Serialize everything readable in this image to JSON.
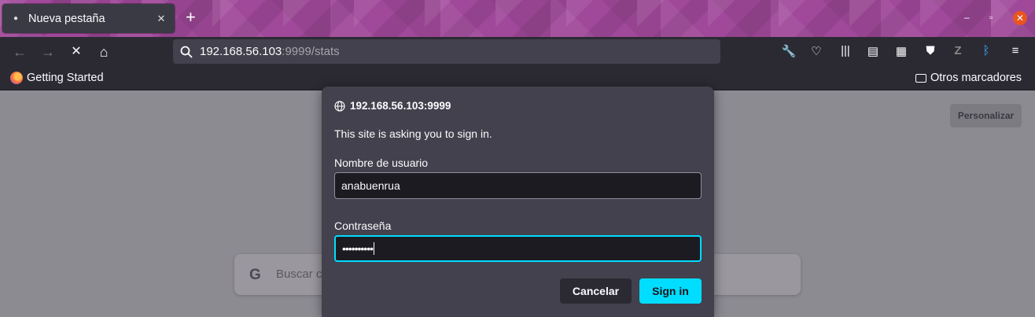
{
  "tab": {
    "title": "Nueva pestaña",
    "close_glyph": "✕",
    "new_tab_glyph": "+",
    "icon": "firefox-mask-icon"
  },
  "window_controls": {
    "minimize": "–",
    "maximize": "▫",
    "close": "✕"
  },
  "nav": {
    "back": "←",
    "forward": "→",
    "stop": "✕",
    "home": "⌂",
    "url_host": "192.168.56.103",
    "url_rest": ":9999/stats"
  },
  "toolbar_icons": [
    "wrench-icon",
    "pocket-icon",
    "library-icon",
    "sidebar-icon",
    "extensions-icon",
    "shield-icon",
    "zotero-icon",
    "bluetooth-icon",
    "menu-icon"
  ],
  "bookmarks": {
    "left": "Getting Started",
    "right": "Otros marcadores"
  },
  "newtab_page": {
    "personalize": "Personalizar",
    "search_placeholder": "Buscar c",
    "google_glyph": "G"
  },
  "dialog": {
    "host": "192.168.56.103:9999",
    "message": "This site is asking you to sign in.",
    "username_label": "Nombre de usuario",
    "username_value": "anabuenrua",
    "password_label": "Contraseña",
    "password_value": "••••••••••",
    "cancel": "Cancelar",
    "sign_in": "Sign in"
  },
  "colors": {
    "accent": "#00ddff",
    "chrome": "#2b2a33",
    "dialog": "#42414d",
    "tabstrip": "#a04899",
    "close": "#e95420"
  }
}
